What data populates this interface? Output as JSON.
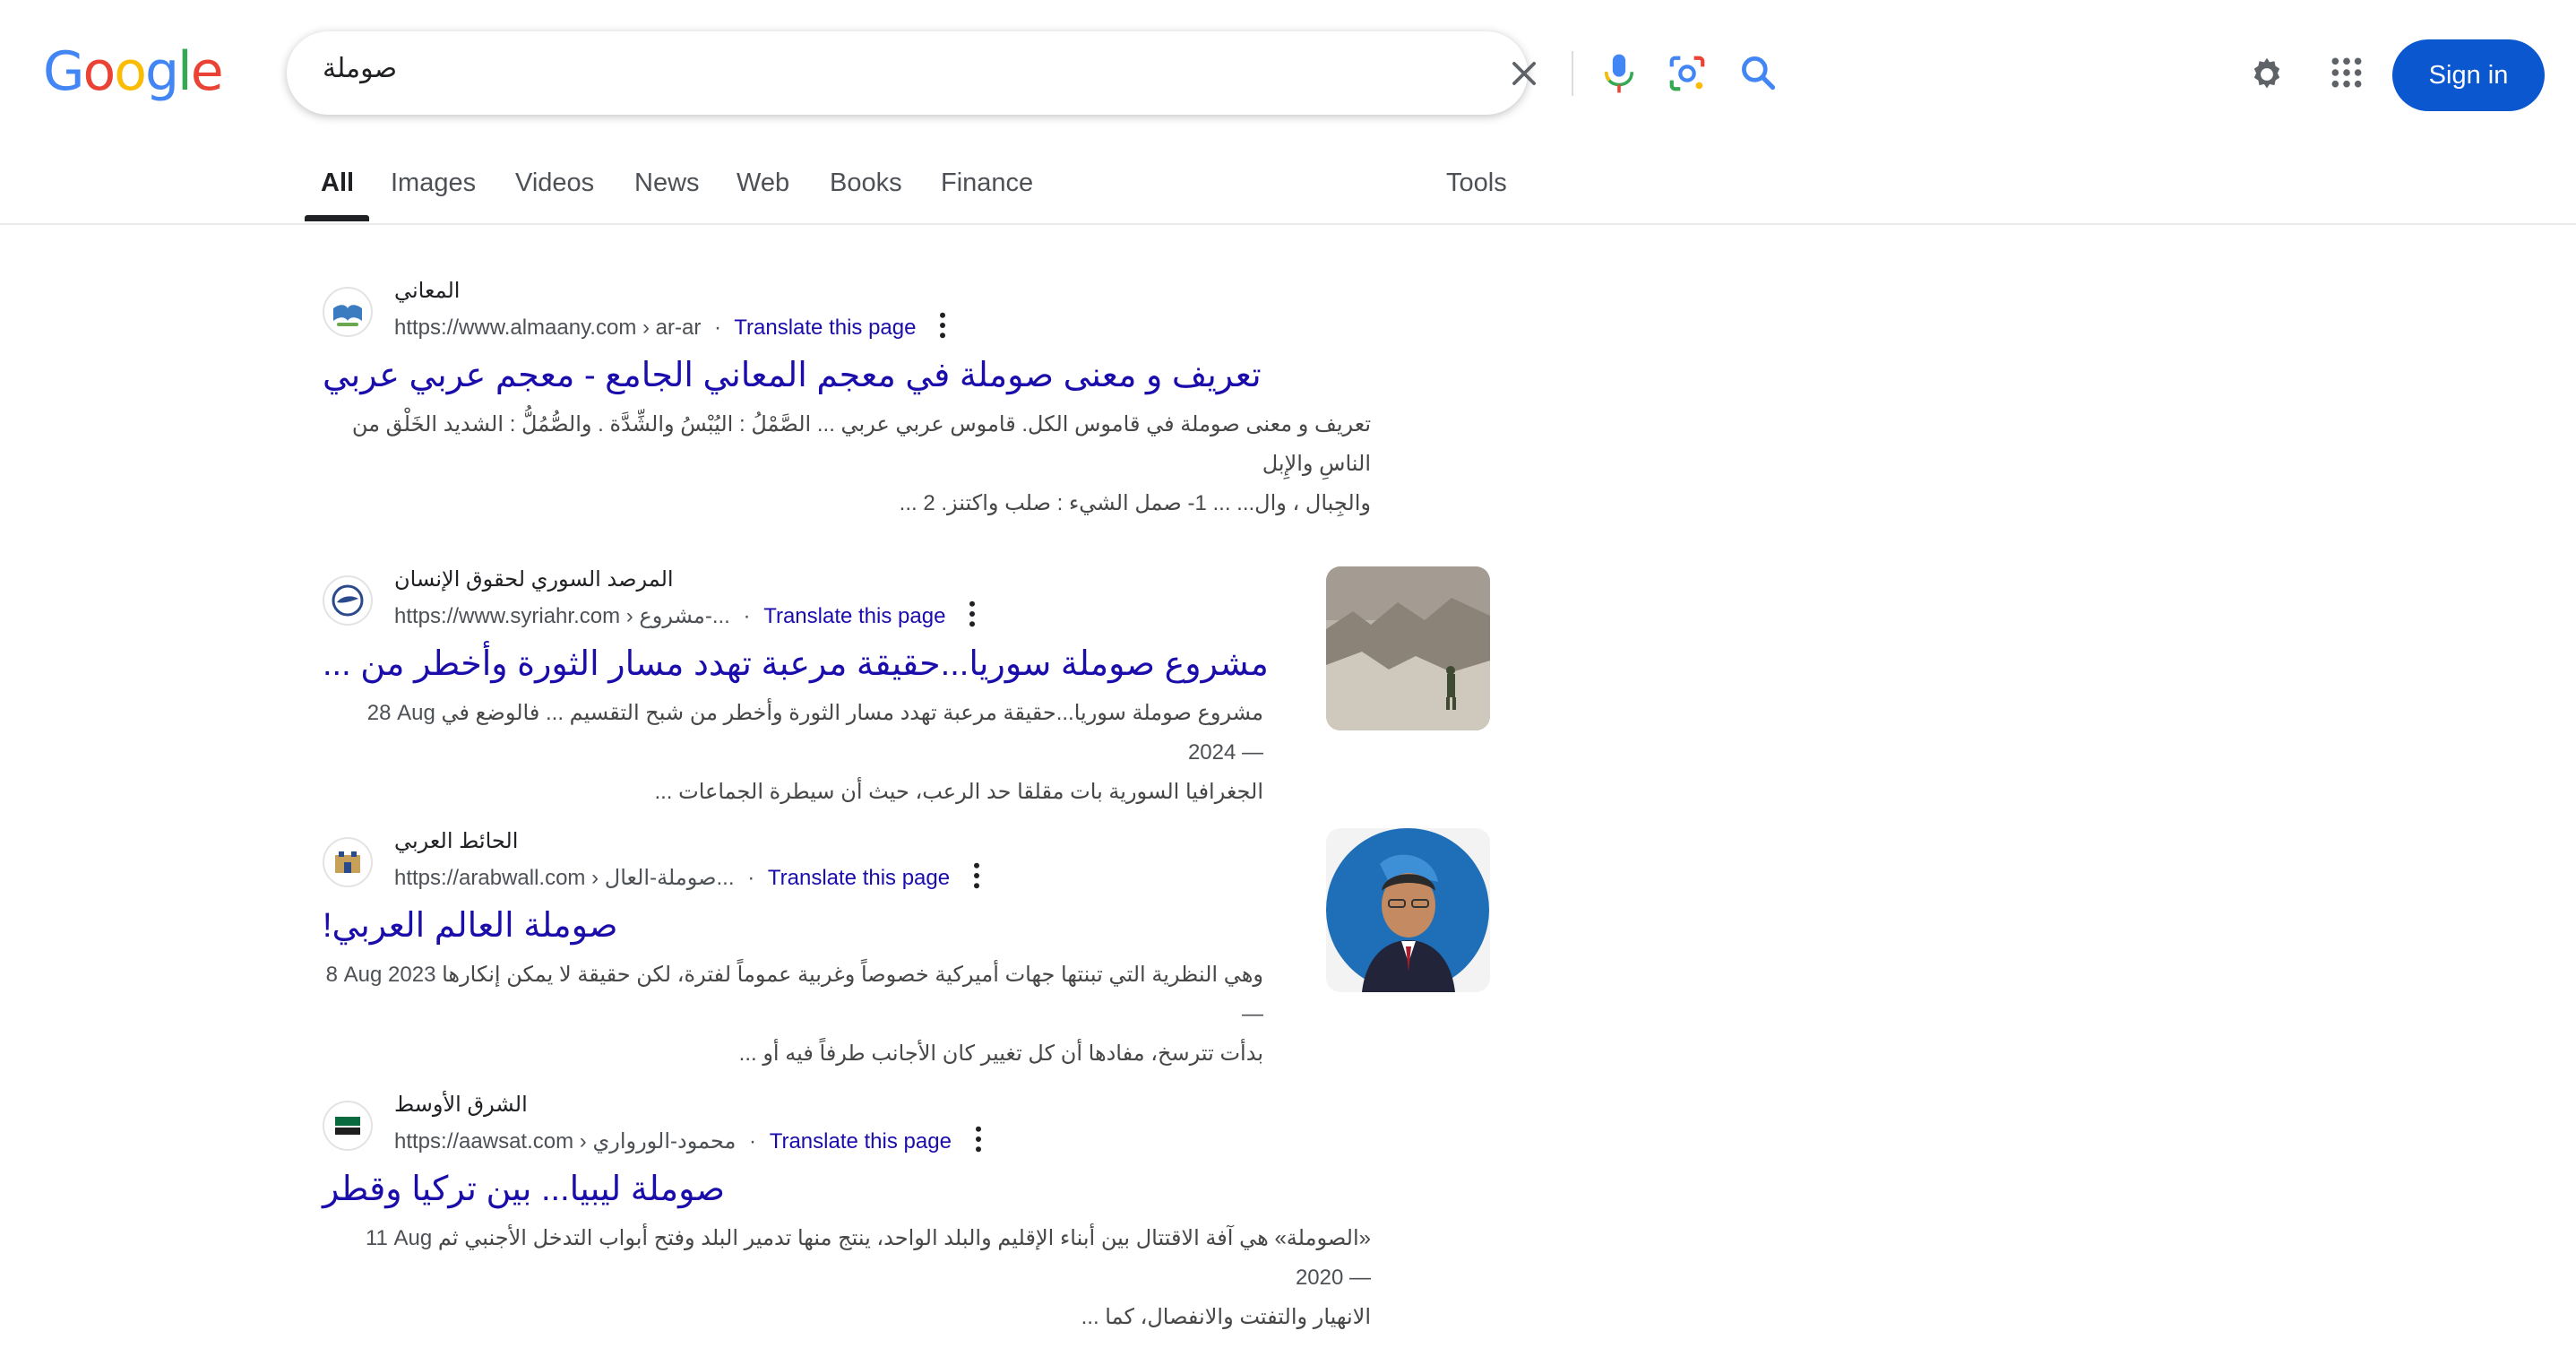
{
  "logo": {
    "letters": [
      "G",
      "o",
      "o",
      "g",
      "l",
      "e"
    ],
    "colors": [
      "#4285f4",
      "#ea4335",
      "#fbbc05",
      "#4285f4",
      "#34a853",
      "#ea4335"
    ]
  },
  "search": {
    "query": "صوملة",
    "clear_icon": "close-icon",
    "voice_icon": "microphone-icon",
    "lens_icon": "camera-lens-icon",
    "submit_icon": "search-icon"
  },
  "header": {
    "settings_icon": "gear-icon",
    "apps_icon": "apps-grid-icon",
    "signin_label": "Sign in",
    "accent": "#0b57d0"
  },
  "tabs": [
    {
      "label": "All",
      "active": true
    },
    {
      "label": "Images"
    },
    {
      "label": "Videos"
    },
    {
      "label": "News"
    },
    {
      "label": "Web"
    },
    {
      "label": "Books"
    },
    {
      "label": "Finance"
    }
  ],
  "tools_label": "Tools",
  "results": [
    {
      "site_name": "المعاني",
      "url": "https://www.almaany.com",
      "path": "› ar-ar",
      "translate": "Translate this page",
      "title": "تعريف و معنى صوملة في معجم المعاني الجامع - معجم عربي عربي",
      "date": "",
      "snippet_line1": "تعريف و معنى صوملة في قاموس الكل. قاموس عربي عربي ... الصَّمْلُ : اليُبْسُ والشِّدَّة . والصُّمُلُّ : الشديد الخَلْق من الناسِ والإِبل",
      "snippet_line2": "والجِبال ، وال... ... 1- صمل الشيء : صلب واكتنز. 2 ..."
    },
    {
      "site_name": "المرصد السوري لحقوق الإنسان",
      "url": "https://www.syriahr.com",
      "path": "› مشروع-...",
      "translate": "Translate this page",
      "title": "مشروع صوملة سوريا...حقيقة مرعبة تهدد مسار الثورة وأخطر من ...",
      "date": "28 Aug 2024 —",
      "snippet_line1": "مشروع صوملة سوريا...حقيقة مرعبة تهدد مسار الثورة وأخطر من شبح التقسيم ... فالوضع في",
      "snippet_line2": "الجغرافيا السورية بات مقلقا حد الرعب، حيث أن سيطرة الجماعات ..."
    },
    {
      "site_name": "الحائط العربي",
      "url": "https://arabwall.com",
      "path": "› صوملة-العال...",
      "translate": "Translate this page",
      "title": "صوملة العالم العربي!",
      "date": "8 Aug 2023 —",
      "snippet_line1": "وهي النظرية التي تبنتها جهات أميركية خصوصاً وغربية عموماً لفترة، لكن حقيقة لا يمكن إنكارها",
      "snippet_line2": "بدأت تترسخ، مفادها أن كل تغيير كان الأجانب طرفاً فيه أو ..."
    },
    {
      "site_name": "الشرق الأوسط",
      "url": "https://aawsat.com",
      "path": "› محمود-الورواري",
      "translate": "Translate this page",
      "title": "صوملة ليبيا... بين تركيا وقطر",
      "date": "11 Aug 2020 —",
      "snippet_line1": "«الصوملة» هي آفة الاقتتال بين أبناء الإقليم والبلد الواحد، ينتج منها تدمير البلد وفتح أبواب التدخل الأجنبي ثم",
      "snippet_line2": "الانهيار والتفتت والانفصال، كما ..."
    }
  ],
  "colors": {
    "link": "#1a0dab",
    "text": "#202124",
    "muted": "#4d5156"
  }
}
